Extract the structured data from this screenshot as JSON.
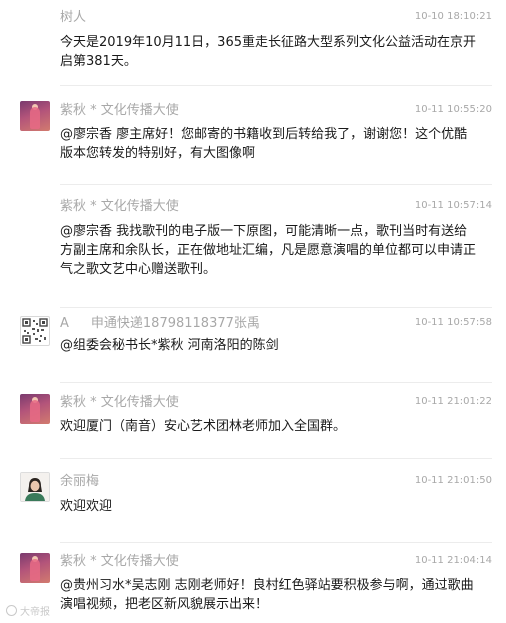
{
  "messages": [
    {
      "avatar": "none",
      "name": "树人",
      "time": "10-10 18:10:21",
      "text": "今天是2019年10月11日，365重走长征路大型系列文化公益活动在京开启第381天。"
    },
    {
      "avatar": "purple-portrait-avatar",
      "name": "紫秋 * 文化传播大使",
      "time": "10-11 10:55:20",
      "text": "@廖宗香 廖主席好！您邮寄的书籍收到后转给我了，谢谢您！这个优酷版本您转发的特别好，有大图像啊"
    },
    {
      "avatar": "none",
      "name": "紫秋 * 文化传播大使",
      "time": "10-11 10:57:14",
      "text": "@廖宗香 我找歌刊的电子版一下原图，可能清晰一点，歌刊当时有送给方副主席和余队长，正在做地址汇编，凡是愿意演唱的单位都可以申请正气之歌文艺中心赠送歌刊。"
    },
    {
      "avatar": "qr-code-avatar",
      "name": "A",
      "name_extra": "申通快递18798118377张禹",
      "time": "10-11 10:57:58",
      "text": "@组委会秘书长*紫秋  河南洛阳的陈剑"
    },
    {
      "avatar": "purple-portrait-avatar",
      "name": "紫秋 * 文化传播大使",
      "time": "10-11 21:01:22",
      "text": "欢迎厦门（南音）安心艺术团林老师加入全国群。"
    },
    {
      "avatar": "person-portrait-avatar",
      "name": "余丽梅",
      "time": "10-11 21:01:50",
      "text": "欢迎欢迎"
    },
    {
      "avatar": "purple-portrait-avatar",
      "name": "紫秋 * 文化传播大使",
      "time": "10-11 21:04:14",
      "text": "@贵州习水*吴志刚 志刚老师好！良村红色驿站要积极参与啊，通过歌曲演唱视频，把老区新风貌展示出来！"
    }
  ],
  "watermark": {
    "icon": "circle-logo-icon",
    "text": "大帝报"
  }
}
